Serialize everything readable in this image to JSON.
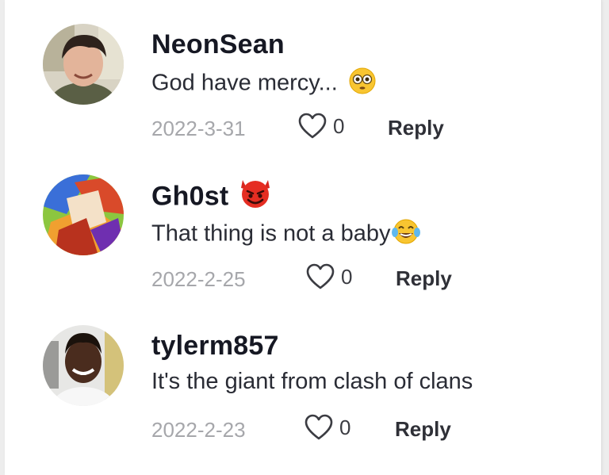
{
  "comments": [
    {
      "username": "NeonSean",
      "username_emoji": "",
      "text": "God have mercy...",
      "text_emoji": "flushed-face",
      "date": "2022-3-31",
      "like_count": "0",
      "reply_label": "Reply"
    },
    {
      "username": "Gh0st",
      "username_emoji": "smiling-devil-face",
      "text": "That thing is not a baby",
      "text_emoji": "tears-of-joy-face",
      "date": "2022-2-25",
      "like_count": "0",
      "reply_label": "Reply"
    },
    {
      "username": "tylerm857",
      "username_emoji": "",
      "text": "It's the giant from clash of clans",
      "text_emoji": "",
      "date": "2022-2-23",
      "like_count": "0",
      "reply_label": "Reply"
    }
  ],
  "icons": {
    "like": "heart-outline-icon"
  }
}
